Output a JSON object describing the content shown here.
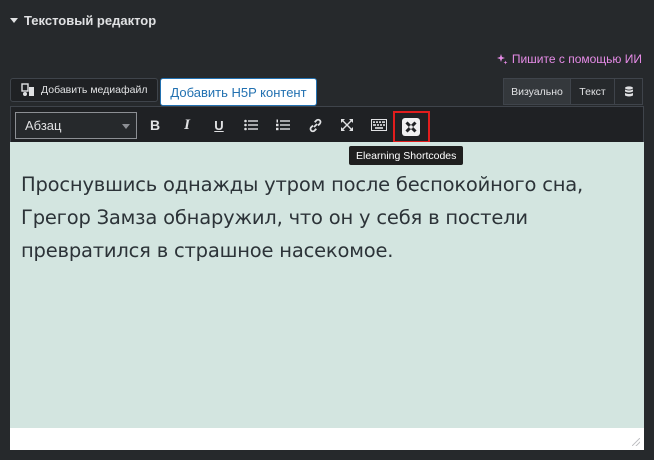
{
  "section": {
    "title": "Текстовый редактор"
  },
  "ai": {
    "label": "Пишите с помощью ИИ"
  },
  "buttons": {
    "add_media": "Добавить медиафайл",
    "add_h5p": "Добавить H5P контент"
  },
  "mode_tabs": {
    "visual": "Визуально",
    "text": "Текст"
  },
  "toolbar": {
    "format_value": "Абзац",
    "bold": "B",
    "italic": "I",
    "underline": "U"
  },
  "tooltip": {
    "text": "Elearning Shortcodes"
  },
  "editor": {
    "content": "Проснувшись однажды утром после беспокойного сна, Грегор Замза обнаружил, что он у себя в постели превратился в страшное насекомое."
  },
  "colors": {
    "panel_bg": "#26292c",
    "editor_bg": "#d3e5e0",
    "ai_accent": "#e58be6",
    "h5p_blue": "#2271b1",
    "highlight": "#e11d1d"
  }
}
